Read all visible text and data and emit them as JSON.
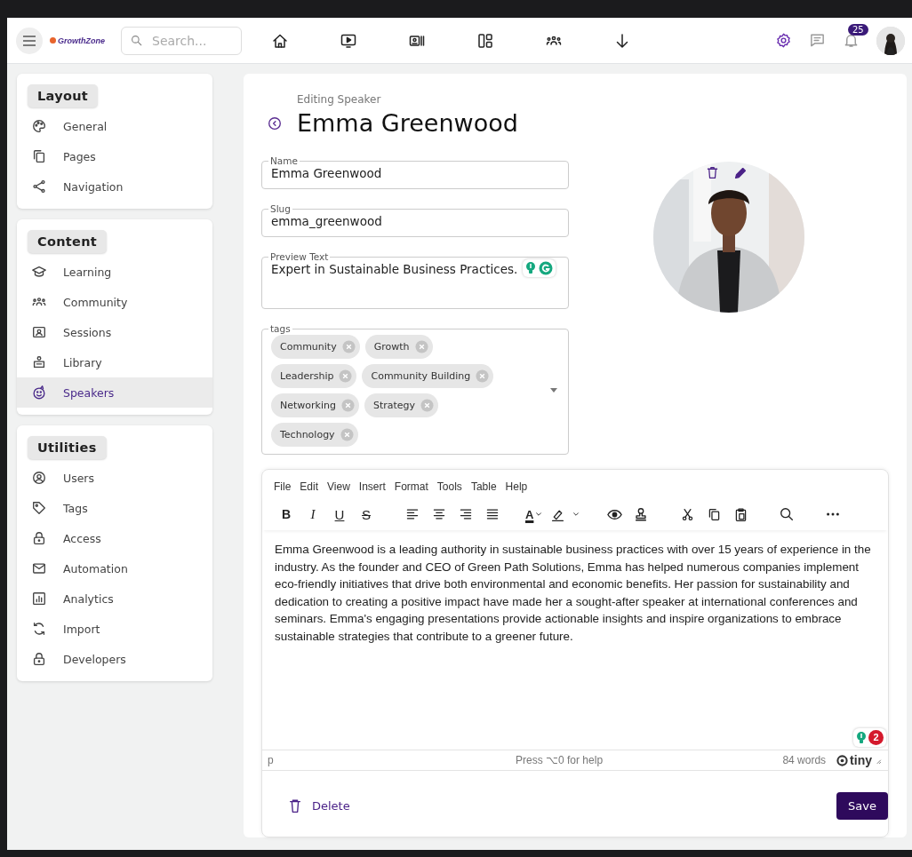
{
  "topbar": {
    "logo": "GrowthZone",
    "search": {
      "placeholder": "Search..."
    },
    "notifications": "25"
  },
  "sidebar": [
    {
      "title": "Layout",
      "items": [
        {
          "label": "General",
          "selected": false
        },
        {
          "label": "Pages",
          "selected": false
        },
        {
          "label": "Navigation",
          "selected": false
        }
      ]
    },
    {
      "title": "Content",
      "items": [
        {
          "label": "Learning",
          "selected": false
        },
        {
          "label": "Community",
          "selected": false
        },
        {
          "label": "Sessions",
          "selected": false
        },
        {
          "label": "Library",
          "selected": false
        },
        {
          "label": "Speakers",
          "selected": true
        }
      ]
    },
    {
      "title": "Utilities",
      "items": [
        {
          "label": "Users",
          "selected": false
        },
        {
          "label": "Tags",
          "selected": false
        },
        {
          "label": "Access",
          "selected": false
        },
        {
          "label": "Automation",
          "selected": false
        },
        {
          "label": "Analytics",
          "selected": false
        },
        {
          "label": "Import",
          "selected": false
        },
        {
          "label": "Developers",
          "selected": false
        }
      ]
    }
  ],
  "editor": {
    "subtitle": "Editing Speaker",
    "title": "Emma Greenwood",
    "fields": [
      {
        "label": "Name",
        "value": "Emma Greenwood"
      },
      {
        "label": "Slug",
        "value": "emma_greenwood"
      },
      {
        "label": "Preview Text",
        "value": "Expert in Sustainable Business Practices."
      }
    ],
    "tags": {
      "label": "tags",
      "chips": [
        [
          "Community",
          "Growth"
        ],
        [
          "Leadership",
          "Community Building"
        ],
        [
          "Networking",
          "Strategy"
        ],
        [
          "Technology"
        ]
      ]
    },
    "rich_text": {
      "menu": [
        "File",
        "Edit",
        "View",
        "Insert",
        "Format",
        "Tools",
        "Table",
        "Help"
      ],
      "format_buttons": [
        "B",
        "I",
        "U",
        "S"
      ],
      "text_color": "A",
      "body": "Emma Greenwood is a leading authority in sustainable business practices with over 15 years of experience in the industry. As the founder and CEO of Green Path Solutions, Emma has helped numerous companies implement eco-friendly initiatives that drive both environmental and economic benefits. Her passion for sustainability and dedication to creating a positive impact have made her a sought-after speaker at international conferences and seminars. Emma's engaging presentations provide actionable insights and inspire organizations to embrace sustainable strategies that contribute to a greener future.",
      "grammar_issues": "2",
      "path": "p",
      "help": "Press ⌥0 for help",
      "word_count": "84 words",
      "brand": "tiny"
    },
    "delete": "Delete",
    "save": "Save"
  }
}
